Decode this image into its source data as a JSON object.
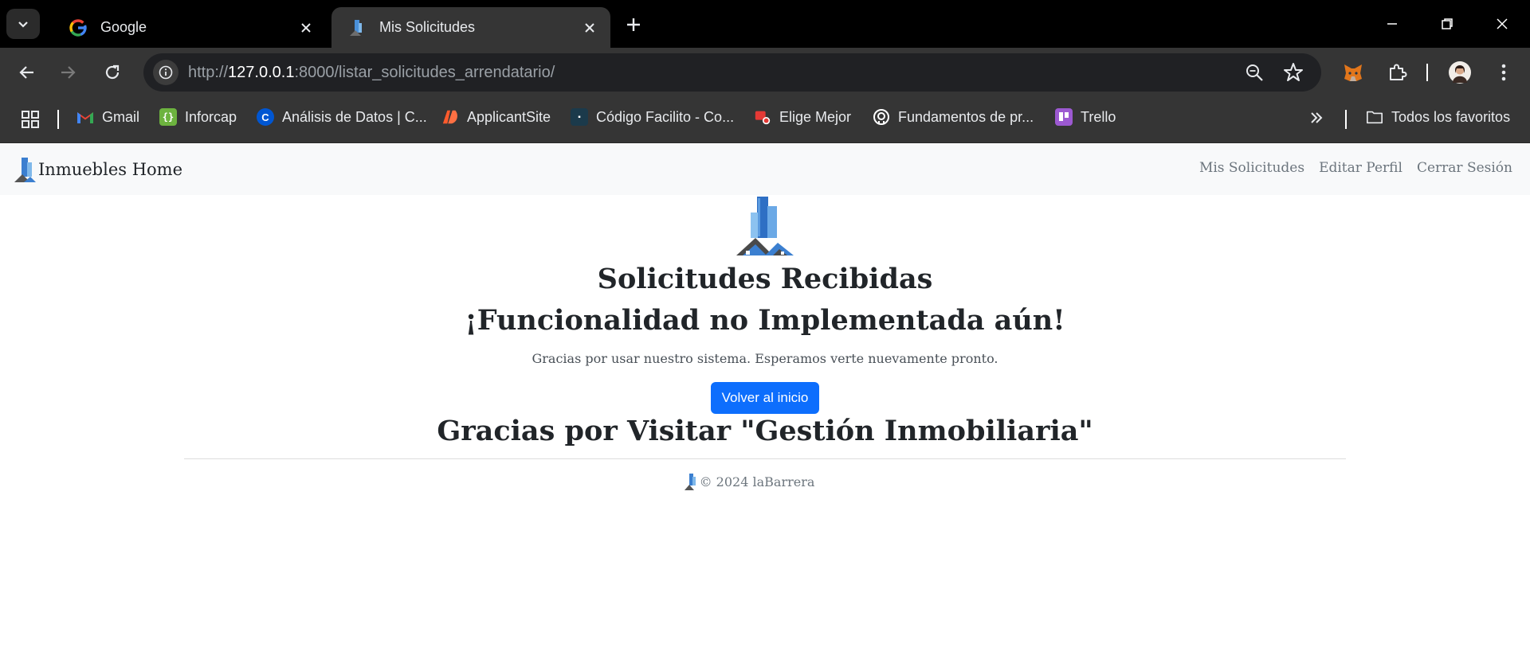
{
  "browser": {
    "tabs": [
      {
        "title": "Google",
        "active": false
      },
      {
        "title": "Mis Solicitudes",
        "active": true
      }
    ],
    "url": {
      "scheme": "http://",
      "host": "127.0.0.1",
      "rest": ":8000/listar_solicitudes_arrendatario/"
    },
    "bookmarks": [
      {
        "label": "Gmail",
        "icon": "gmail-icon",
        "color": "#ea4335"
      },
      {
        "label": "Inforcap",
        "icon": "inforcap-icon",
        "color": "#6db33f"
      },
      {
        "label": "Análisis de Datos | C...",
        "icon": "coursera-icon",
        "color": "#0056d2"
      },
      {
        "label": "ApplicantSite",
        "icon": "applicantsite-icon",
        "color": "#ff5a2c"
      },
      {
        "label": "Código Facilito - Co...",
        "icon": "codigofacilito-icon",
        "color": "#1b3a4b"
      },
      {
        "label": "Elige Mejor",
        "icon": "eligemejor-icon",
        "color": "#e53935"
      },
      {
        "label": "Fundamentos de pr...",
        "icon": "github-icon",
        "color": "#ffffff"
      },
      {
        "label": "Trello",
        "icon": "trello-icon",
        "color": "#9c59d1"
      }
    ],
    "all_bookmarks": "Todos los favoritos"
  },
  "site": {
    "brand": "Inmuebles Home",
    "nav": [
      "Mis Solicitudes",
      "Editar Perfil",
      "Cerrar Sesión"
    ],
    "heading": "Solicitudes Recibidas",
    "subheading": "¡Funcionalidad no Implementada aún!",
    "lead": "Gracias por usar nuestro sistema. Esperamos verte nuevamente pronto.",
    "button": "Volver al inicio",
    "thanks": "Gracias por Visitar \"Gestión Inmobiliaria\"",
    "footer": "© 2024 laBarrera"
  },
  "colors": {
    "primary": "#0d6efd",
    "navbar_bg": "#f8f9fa"
  }
}
